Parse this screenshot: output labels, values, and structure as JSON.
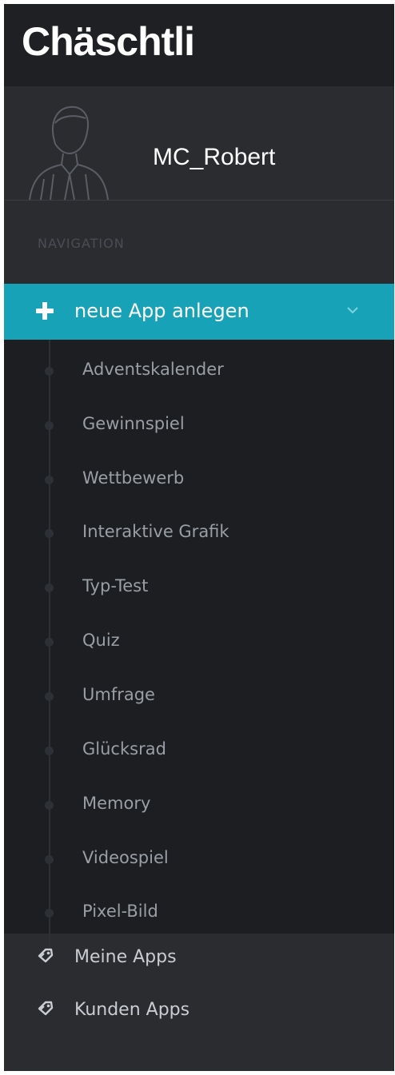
{
  "brand": {
    "title": "Chäschtli"
  },
  "profile": {
    "username": "MC_Robert"
  },
  "navigation": {
    "heading": "NAVIGATION",
    "active": {
      "label": "neue App anlegen",
      "icon": "plus-icon"
    },
    "sub_items": [
      {
        "label": "Adventskalender"
      },
      {
        "label": "Gewinnspiel"
      },
      {
        "label": "Wettbewerb"
      },
      {
        "label": "Interaktive Grafik"
      },
      {
        "label": "Typ-Test"
      },
      {
        "label": "Quiz"
      },
      {
        "label": "Umfrage"
      },
      {
        "label": "Glücksrad"
      },
      {
        "label": "Memory"
      },
      {
        "label": "Videospiel"
      },
      {
        "label": "Pixel-Bild"
      }
    ],
    "main_items": [
      {
        "label": "Meine Apps",
        "icon": "tag-icon"
      },
      {
        "label": "Kunden Apps",
        "icon": "tag-icon"
      }
    ]
  },
  "colors": {
    "accent": "#17a2b8",
    "sidebar_bg": "#2a2c30",
    "brand_bg": "#1f2023",
    "submenu_bg": "#1c1e21"
  }
}
